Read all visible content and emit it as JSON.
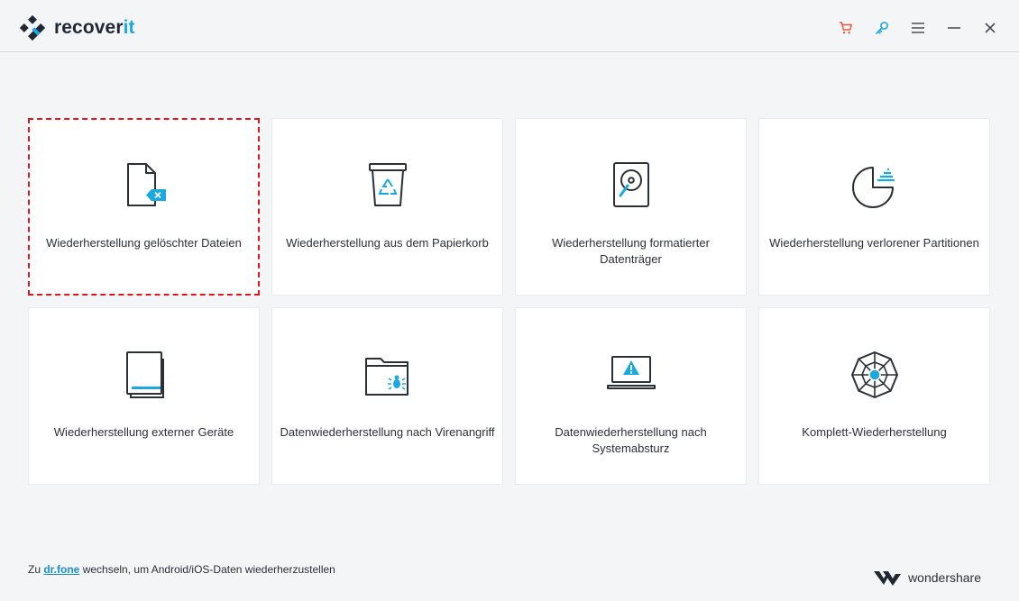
{
  "app": {
    "logo_text_main": "recover",
    "logo_text_accent": "it"
  },
  "colors": {
    "accent": "#1aa8e0",
    "cart": "#e8573c",
    "selected_border": "#e0161e",
    "icon_stroke": "#2b2f36"
  },
  "window_controls": {
    "icons": [
      "cart-icon",
      "key-icon",
      "menu-icon",
      "minimize-icon",
      "close-icon"
    ]
  },
  "cards": [
    {
      "label": "Wiederherstellung gelöschter Dateien",
      "icon": "deleted-file-icon",
      "selected": true
    },
    {
      "label": "Wiederherstellung aus dem Papierkorb",
      "icon": "recycle-bin-icon",
      "selected": false
    },
    {
      "label": "Wiederherstellung formatierter Datenträger",
      "icon": "hard-drive-icon",
      "selected": false
    },
    {
      "label": "Wiederherstellung verlorener Partitionen",
      "icon": "partition-pie-icon",
      "selected": false
    },
    {
      "label": "Wiederherstellung externer Geräte",
      "icon": "external-device-icon",
      "selected": false
    },
    {
      "label": "Datenwiederherstellung nach Virenangriff",
      "icon": "virus-folder-icon",
      "selected": false
    },
    {
      "label": "Datenwiederherstellung nach Systemabsturz",
      "icon": "system-crash-laptop-icon",
      "selected": false
    },
    {
      "label": "Komplett-Wiederherstellung",
      "icon": "complete-recovery-icon",
      "selected": false
    }
  ],
  "footer": {
    "prefix": "Zu ",
    "link": "dr.fone",
    "suffix": " wechseln, um Android/iOS-Daten wiederherzustellen",
    "brand": "wondershare"
  }
}
